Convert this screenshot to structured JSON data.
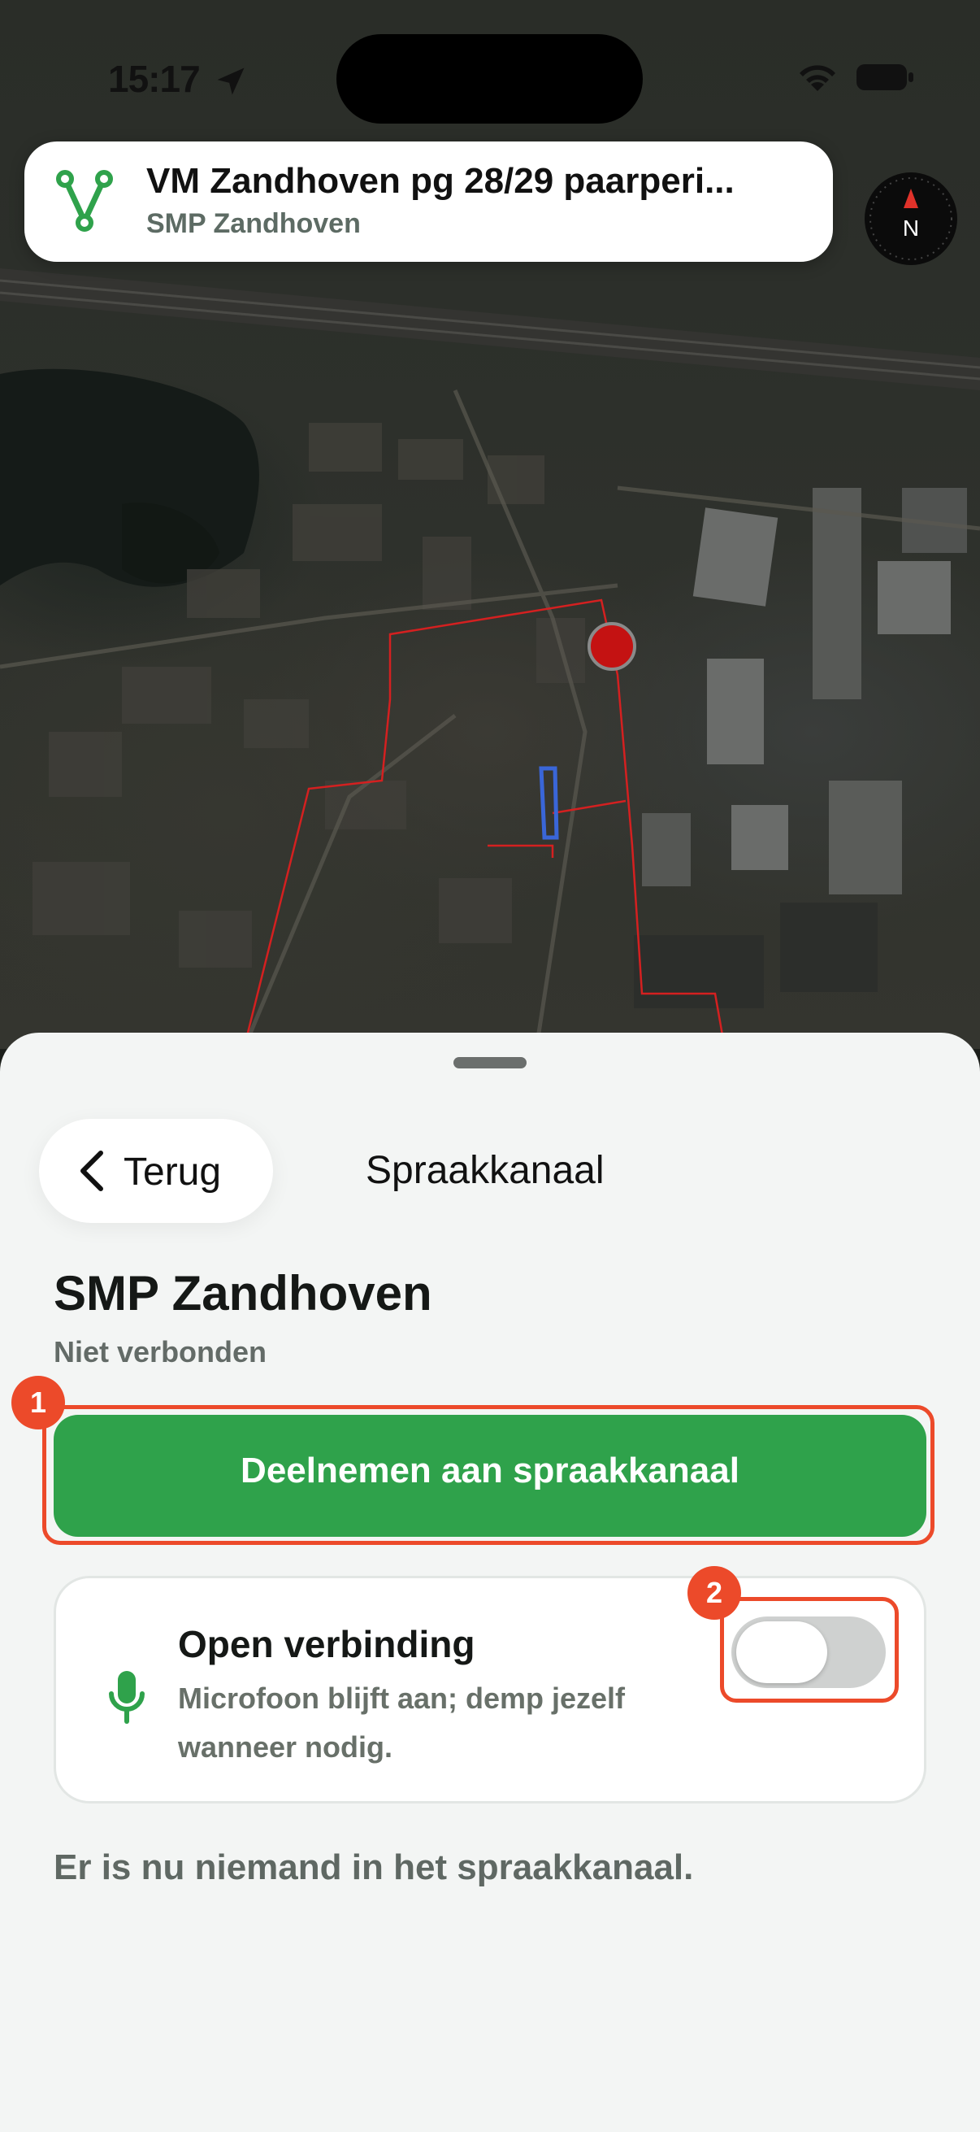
{
  "status_bar": {
    "time": "15:17"
  },
  "header": {
    "title": "VM Zandhoven pg 28/29 paarperi...",
    "subtitle": "SMP Zandhoven",
    "compass_letter": "N"
  },
  "sheet": {
    "back_label": "Terug",
    "title": "Spraakkanaal",
    "channel_name": "SMP Zandhoven",
    "channel_status": "Niet verbonden",
    "join_label": "Deelnemen aan spraakkanaal",
    "option": {
      "title": "Open verbinding",
      "description": "Microfoon blijft aan; demp jezelf wanneer nodig.",
      "toggle_on": false
    },
    "empty_message": "Er is nu niemand in het spraakkanaal."
  },
  "annotations": {
    "badge_1": "1",
    "badge_2": "2"
  },
  "colors": {
    "accent": "#2fa24b",
    "highlight": "#ec4a2a",
    "boundary": "#d42020"
  },
  "icons": [
    "location-arrow-icon",
    "wifi-icon",
    "battery-icon",
    "app-logo-icon",
    "compass-icon",
    "chevron-left-icon",
    "microphone-icon"
  ]
}
